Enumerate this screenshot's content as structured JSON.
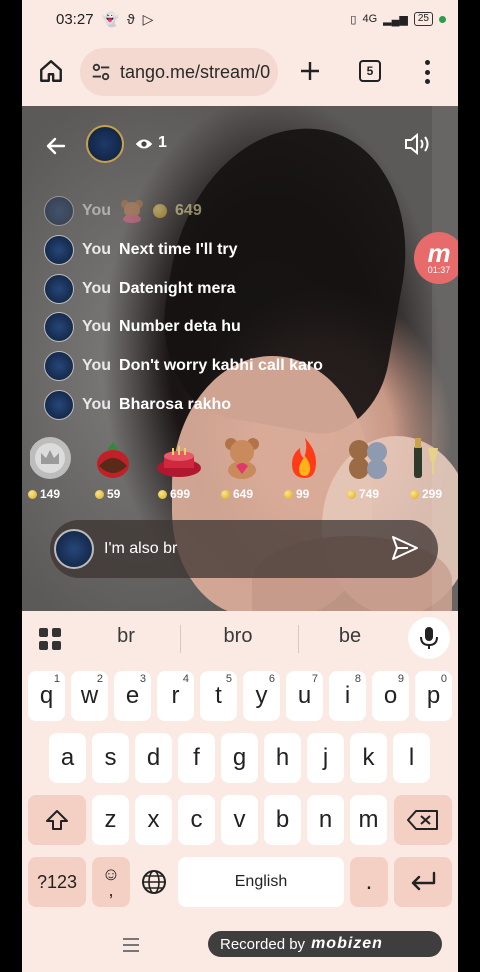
{
  "status_bar": {
    "time": "03:27",
    "battery": "25",
    "network": "4G"
  },
  "browser": {
    "url": "tango.me/stream/0",
    "tab_count": "5"
  },
  "stream": {
    "viewer_count": "1",
    "recording_timer": "01:37",
    "chat": [
      {
        "name": "You",
        "message": "649",
        "type": "gift"
      },
      {
        "name": "You",
        "message": "Next time I'll try"
      },
      {
        "name": "You",
        "message": "Datenight mera"
      },
      {
        "name": "You",
        "message": "Number deta hu"
      },
      {
        "name": "You",
        "message": "Don't worry kabhi call karo"
      },
      {
        "name": "You",
        "message": "Bharosa rakho"
      }
    ],
    "gifts": [
      {
        "name": "crown",
        "price": "149"
      },
      {
        "name": "chocolate-strawberry",
        "price": "59"
      },
      {
        "name": "cake",
        "price": "699"
      },
      {
        "name": "teddy-heart",
        "price": "649"
      },
      {
        "name": "fire",
        "price": "99"
      },
      {
        "name": "teddy-pair",
        "price": "749"
      },
      {
        "name": "champagne",
        "price": "299"
      }
    ],
    "input_value": "I'm also br"
  },
  "keyboard": {
    "suggestions": [
      "br",
      "bro",
      "be"
    ],
    "row1": [
      {
        "k": "q",
        "n": "1"
      },
      {
        "k": "w",
        "n": "2"
      },
      {
        "k": "e",
        "n": "3"
      },
      {
        "k": "r",
        "n": "4"
      },
      {
        "k": "t",
        "n": "5"
      },
      {
        "k": "y",
        "n": "6"
      },
      {
        "k": "u",
        "n": "7"
      },
      {
        "k": "i",
        "n": "8"
      },
      {
        "k": "o",
        "n": "9"
      },
      {
        "k": "p",
        "n": "0"
      }
    ],
    "row2": [
      "a",
      "s",
      "d",
      "f",
      "g",
      "h",
      "j",
      "k",
      "l"
    ],
    "row3": [
      "z",
      "x",
      "c",
      "v",
      "b",
      "n",
      "m"
    ],
    "sym_label": "?123",
    "emoji_label": "☺",
    "emoji_sub": ",",
    "space_label": "English",
    "period_label": "."
  },
  "nav": {
    "recorded_label": "Recorded by",
    "brand": "mobizen"
  }
}
